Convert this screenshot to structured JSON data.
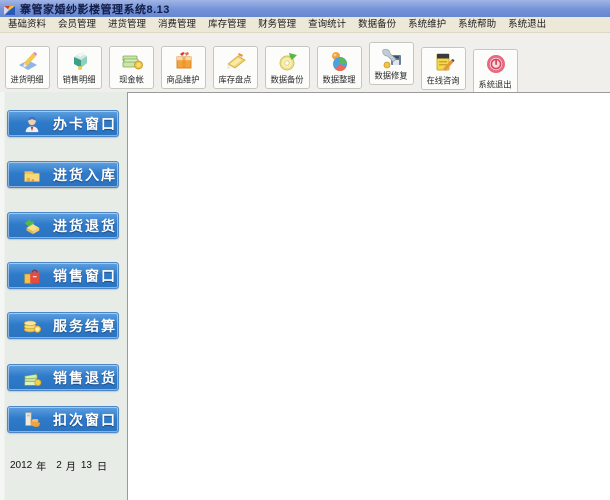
{
  "window": {
    "title": "寨管家婚纱影楼管理系统8.13",
    "icon": "app-flag-icon"
  },
  "menubar": {
    "items": [
      "基础资料",
      "会员管理",
      "进货管理",
      "消费管理",
      "库存管理",
      "财务管理",
      "查询统计",
      "数据备份",
      "系统维护",
      "系统帮助",
      "系统退出"
    ]
  },
  "toolbar": {
    "buttons": [
      {
        "label": "进货明细",
        "icon": "purchase-detail-icon"
      },
      {
        "label": "销售明细",
        "icon": "sales-detail-icon"
      },
      {
        "label": "现金帐",
        "icon": "cash-book-icon"
      },
      {
        "label": "商品维护",
        "icon": "goods-maintain-icon"
      },
      {
        "label": "库存盘点",
        "icon": "stock-check-icon"
      },
      {
        "label": "数据备份",
        "icon": "data-backup-icon"
      },
      {
        "label": "数据整理",
        "icon": "data-organize-icon"
      },
      {
        "label": "数据修复",
        "icon": "data-repair-icon"
      },
      {
        "label": "在线咨询",
        "icon": "online-consult-icon"
      },
      {
        "label": "系统退出",
        "icon": "system-exit-icon"
      }
    ]
  },
  "sidebar": {
    "buttons": [
      {
        "label": "办卡窗口",
        "icon": "member-person-icon"
      },
      {
        "label": "进货入库",
        "icon": "inbox-folder-icon"
      },
      {
        "label": "进货退货",
        "icon": "purchase-return-icon"
      },
      {
        "label": "销售窗口",
        "icon": "shopping-bag-icon"
      },
      {
        "label": "服务结算",
        "icon": "coins-icon"
      },
      {
        "label": "销售退货",
        "icon": "banknotes-icon"
      },
      {
        "label": "扣次窗口",
        "icon": "pointing-hand-icon"
      }
    ],
    "date": {
      "year": "2012",
      "year_unit": "年",
      "month": "2",
      "month_unit": "月",
      "day": "13",
      "day_unit": "日"
    }
  },
  "colors": {
    "titlebar_blue": "#7392d8",
    "menubar_beige": "#ece9d8",
    "toolbar_bg": "#f0efec",
    "sidebar_bg": "#e8ece7",
    "sidebar_button_blue": "#2f7bc9",
    "workspace_white": "#ffffff",
    "exit_red": "#e8697f"
  }
}
